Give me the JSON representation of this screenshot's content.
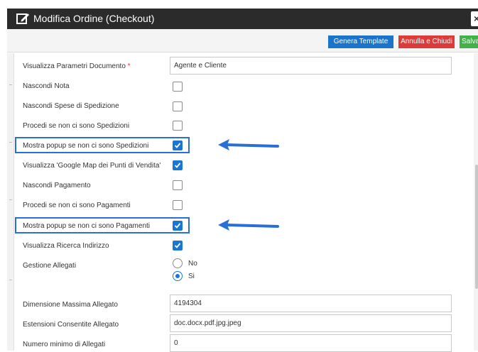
{
  "window": {
    "title": "Modifica Ordine (Checkout)",
    "close_glyph": "×"
  },
  "toolbar": {
    "generate_template_label": "Genera Template",
    "cancel_close_label": "Annulla e Chiudi",
    "save_label": "Salva"
  },
  "form": {
    "document_params": {
      "label": "Visualizza Parametri Documento",
      "required_mark": "*",
      "value": "Agente e Cliente"
    },
    "options": [
      {
        "label": "Nascondi Nota",
        "checked": false
      },
      {
        "label": "Nascondi Spese di Spedizione",
        "checked": false
      },
      {
        "label": "Procedi se non ci sono Spedizioni",
        "checked": false
      },
      {
        "label": "Mostra popup se non ci sono Spedizioni",
        "checked": true
      },
      {
        "label": "Visualizza 'Google Map dei Punti di Vendita'",
        "checked": true
      },
      {
        "label": "Nascondi Pagamento",
        "checked": false
      },
      {
        "label": "Procedi se non ci sono Pagamenti",
        "checked": false
      },
      {
        "label": "Mostra popup se non ci sono Pagamenti",
        "checked": true
      },
      {
        "label": "Visualizza Ricerca Indirizzo",
        "checked": true
      }
    ],
    "attachments": {
      "label": "Gestione Allegati",
      "options": [
        {
          "label": "No",
          "selected": false
        },
        {
          "label": "Si",
          "selected": true
        }
      ]
    },
    "max_attachment_size": {
      "label": "Dimensione Massima Allegato",
      "value": "4194304"
    },
    "allowed_extensions": {
      "label": "Estensioni Consentite Allegato",
      "value": "doc.docx.pdf.jpg.jpeg"
    },
    "min_attachments": {
      "label": "Numero minimo di Allegati",
      "value": "0"
    }
  },
  "colors": {
    "accent": "#1976d2",
    "highlight": "#2a6fd6",
    "danger": "#dd3a3a",
    "success": "#43b049",
    "titlebar": "#2b2b2b"
  },
  "icons": {
    "title": "edit-icon",
    "close": "close-icon",
    "arrow": "arrow-left-icon"
  }
}
